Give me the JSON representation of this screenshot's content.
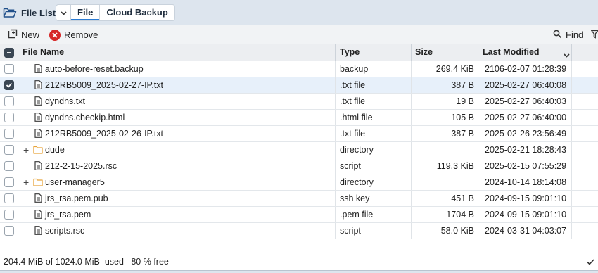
{
  "header": {
    "title": "File List",
    "tabs": [
      {
        "label": "File",
        "active": true
      },
      {
        "label": "Cloud Backup",
        "active": false
      }
    ]
  },
  "toolbar": {
    "new_label": "New",
    "remove_label": "Remove",
    "find_label": "Find"
  },
  "table": {
    "columns": [
      "File Name",
      "Type",
      "Size",
      "Last Modified"
    ],
    "sort_column": "Last Modified",
    "sort_direction": "descending",
    "rows": [
      {
        "name": "auto-before-reset.backup",
        "type": "backup",
        "size": "269.4 KiB",
        "modified": "2106-02-07 01:28:39",
        "kind": "file",
        "checked": false
      },
      {
        "name": "212RB5009_2025-02-27-IP.txt",
        "type": ".txt file",
        "size": "387 B",
        "modified": "2025-02-27 06:40:08",
        "kind": "file",
        "checked": true
      },
      {
        "name": "dyndns.txt",
        "type": ".txt file",
        "size": "19 B",
        "modified": "2025-02-27 06:40:03",
        "kind": "file",
        "checked": false
      },
      {
        "name": "dyndns.checkip.html",
        "type": ".html file",
        "size": "105 B",
        "modified": "2025-02-27 06:40:00",
        "kind": "file",
        "checked": false
      },
      {
        "name": "212RB5009_2025-02-26-IP.txt",
        "type": ".txt file",
        "size": "387 B",
        "modified": "2025-02-26 23:56:49",
        "kind": "file",
        "checked": false
      },
      {
        "name": "dude",
        "type": "directory",
        "size": "",
        "modified": "2025-02-21 18:28:43",
        "kind": "folder",
        "checked": false
      },
      {
        "name": "212-2-15-2025.rsc",
        "type": "script",
        "size": "119.3 KiB",
        "modified": "2025-02-15 07:55:29",
        "kind": "file",
        "checked": false
      },
      {
        "name": "user-manager5",
        "type": "directory",
        "size": "",
        "modified": "2024-10-14 18:14:08",
        "kind": "folder",
        "checked": false
      },
      {
        "name": "jrs_rsa.pem.pub",
        "type": "ssh key",
        "size": "451 B",
        "modified": "2024-09-15 09:01:10",
        "kind": "file",
        "checked": false
      },
      {
        "name": "jrs_rsa.pem",
        "type": ".pem file",
        "size": "1704 B",
        "modified": "2024-09-15 09:01:10",
        "kind": "file",
        "checked": false
      },
      {
        "name": "scripts.rsc",
        "type": "script",
        "size": "58.0 KiB",
        "modified": "2024-03-31 04:03:07",
        "kind": "file",
        "checked": false
      }
    ]
  },
  "status": {
    "text": "204.4 MiB of 1024.0 MiB  used   80 % free"
  },
  "colors": {
    "header_bg": "#dde5ee",
    "selected_row": "#e7f0fa",
    "remove_red": "#d62828",
    "folder_orange": "#e8a33a"
  },
  "icons": {
    "title": "folder-open-icon",
    "new": "new-file-icon",
    "remove": "remove-icon",
    "find": "search-icon",
    "filter": "filter-icon",
    "file": "file-icon",
    "folder": "folder-icon"
  }
}
